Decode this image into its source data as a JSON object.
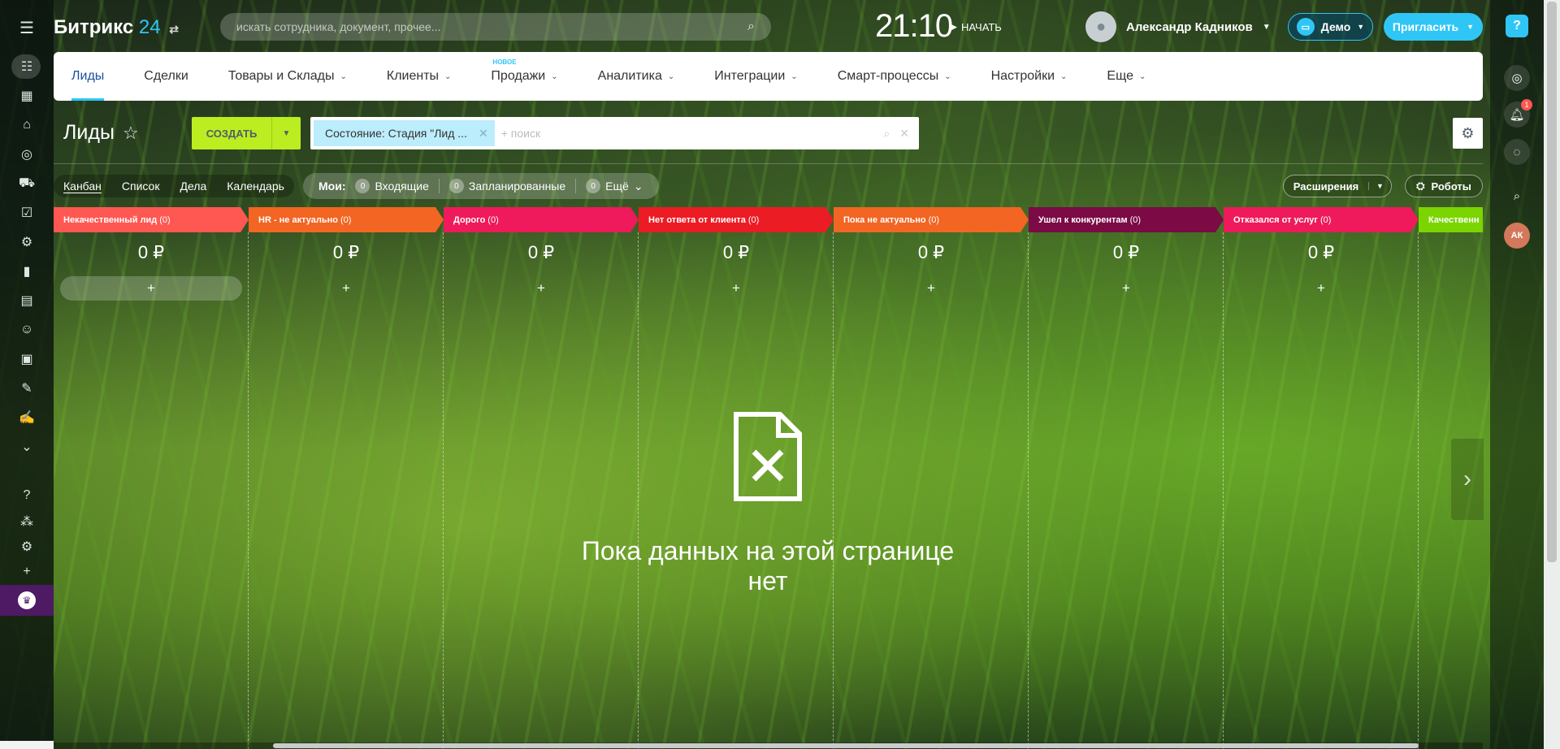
{
  "header": {
    "logo_text": "Битрикс",
    "logo_num": "24",
    "search_placeholder": "искать сотрудника, документ, прочее...",
    "clock": "21:10",
    "start_label": "НАЧАТЬ",
    "user_name": "Александр Кадников",
    "demo_label": "Демо",
    "invite_label": "Пригласить"
  },
  "nav": {
    "tabs": [
      {
        "label": "Лиды"
      },
      {
        "label": "Сделки"
      },
      {
        "label": "Товары и Склады"
      },
      {
        "label": "Клиенты"
      },
      {
        "label": "Продажи",
        "tag": "НОВОЕ"
      },
      {
        "label": "Аналитика"
      },
      {
        "label": "Интеграции"
      },
      {
        "label": "Смарт-процессы"
      },
      {
        "label": "Настройки"
      },
      {
        "label": "Еще"
      }
    ]
  },
  "toolbar": {
    "page_title": "Лиды",
    "create_label": "СОЗДАТЬ",
    "filter_chip": "Состояние: Стадия \"Лид ...",
    "filter_placeholder": "+ поиск",
    "views": [
      "Канбан",
      "Список",
      "Дела",
      "Календарь"
    ],
    "mine_label": "Мои:",
    "counters": [
      {
        "num": "0",
        "label": "Входящие"
      },
      {
        "num": "0",
        "label": "Запланированные"
      },
      {
        "num": "0",
        "label": "Ещё"
      }
    ],
    "extensions_label": "Расширения",
    "robots_label": "Роботы"
  },
  "columns": [
    {
      "title": "Некачественный лид",
      "count": "(0)",
      "sum": "0 ₽",
      "color": "#ff5752"
    },
    {
      "title": "HR - не актуально",
      "count": "(0)",
      "sum": "0 ₽",
      "color": "#f26522"
    },
    {
      "title": "Дорого",
      "count": "(0)",
      "sum": "0 ₽",
      "color": "#ee1a5b"
    },
    {
      "title": "Нет ответа от клиента",
      "count": "(0)",
      "sum": "0 ₽",
      "color": "#ec1c24"
    },
    {
      "title": "Пока не актуально",
      "count": "(0)",
      "sum": "0 ₽",
      "color": "#f26522"
    },
    {
      "title": "Ушел к конкурентам",
      "count": "(0)",
      "sum": "0 ₽",
      "color": "#7b0a45"
    },
    {
      "title": "Отказался от услуг",
      "count": "(0)",
      "sum": "0 ₽",
      "color": "#ee1a5b"
    },
    {
      "title": "Качественн",
      "count": "",
      "sum": "",
      "color": "#7bd500"
    }
  ],
  "empty_state": "Пока данных на этой странице нет",
  "right_bar": {
    "notif_badge": "1",
    "avatar_initials": "АК"
  }
}
